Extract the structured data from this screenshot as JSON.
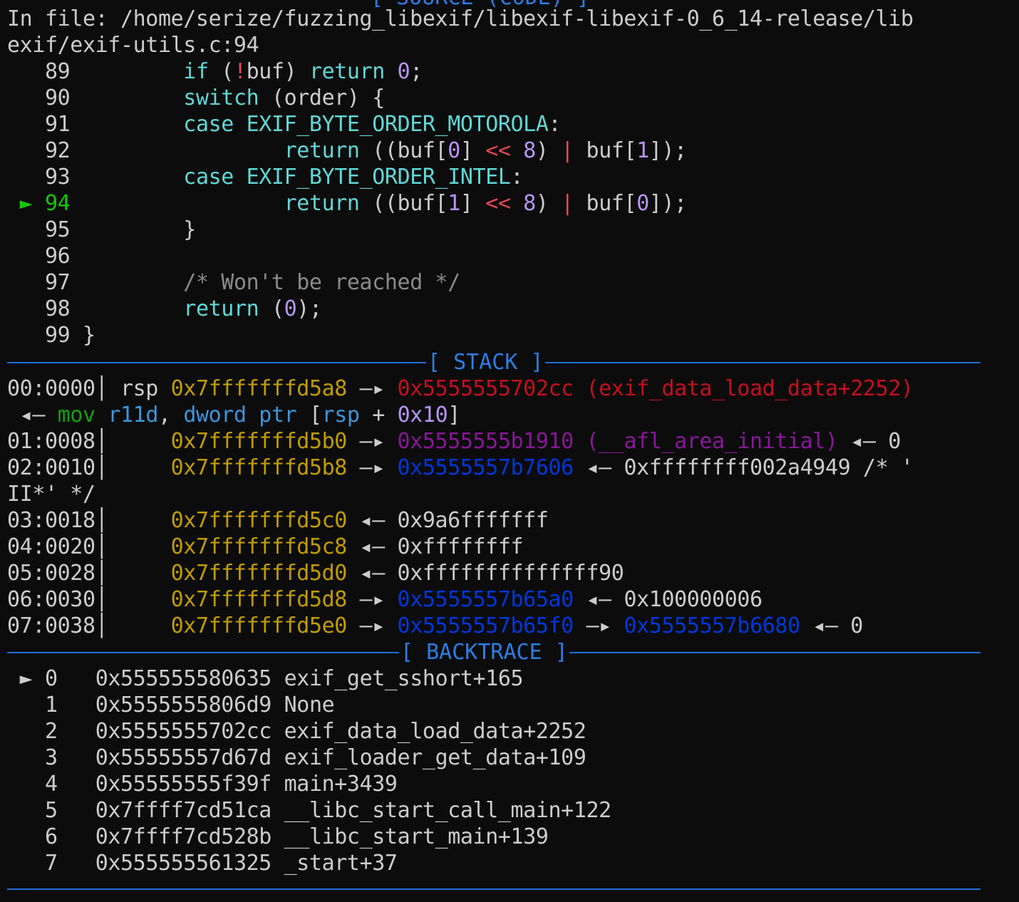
{
  "source": {
    "header_line1": "In file: /home/serize/fuzzing_libexif/libexif-libexif-0_6_14-release/lib",
    "header_line2": "exif/exif-utils.c:94",
    "current_marker": "►",
    "lines": [
      {
        "num": "89",
        "indent": "        ",
        "parts": [
          [
            "kw",
            "if"
          ],
          [
            "t",
            " ("
          ],
          [
            "op",
            "!"
          ],
          [
            "t",
            "buf) "
          ],
          [
            "kw",
            "return"
          ],
          [
            "t",
            " "
          ],
          [
            "num",
            "0"
          ],
          [
            "t",
            ";"
          ]
        ]
      },
      {
        "num": "90",
        "indent": "        ",
        "parts": [
          [
            "kw",
            "switch"
          ],
          [
            "t",
            " (order) {"
          ]
        ]
      },
      {
        "num": "91",
        "indent": "        ",
        "parts": [
          [
            "kw",
            "case"
          ],
          [
            "t",
            " "
          ],
          [
            "kw",
            "EXIF_BYTE_ORDER_MOTOROLA"
          ],
          [
            "t",
            ":"
          ]
        ]
      },
      {
        "num": "92",
        "indent": "                ",
        "parts": [
          [
            "kw",
            "return"
          ],
          [
            "t",
            " ((buf["
          ],
          [
            "num",
            "0"
          ],
          [
            "t",
            "] "
          ],
          [
            "op",
            "<<"
          ],
          [
            "t",
            " "
          ],
          [
            "num",
            "8"
          ],
          [
            "t",
            ") "
          ],
          [
            "op",
            "|"
          ],
          [
            "t",
            " buf["
          ],
          [
            "num",
            "1"
          ],
          [
            "t",
            "]);"
          ]
        ]
      },
      {
        "num": "93",
        "indent": "        ",
        "parts": [
          [
            "kw",
            "case"
          ],
          [
            "t",
            " "
          ],
          [
            "kw",
            "EXIF_BYTE_ORDER_INTEL"
          ],
          [
            "t",
            ":"
          ]
        ]
      },
      {
        "num": "94",
        "indent": "                ",
        "current": true,
        "parts": [
          [
            "kw",
            "return"
          ],
          [
            "t",
            " ((buf["
          ],
          [
            "num",
            "1"
          ],
          [
            "t",
            "] "
          ],
          [
            "op",
            "<<"
          ],
          [
            "t",
            " "
          ],
          [
            "num",
            "8"
          ],
          [
            "t",
            ") "
          ],
          [
            "op",
            "|"
          ],
          [
            "t",
            " buf["
          ],
          [
            "num",
            "0"
          ],
          [
            "t",
            "]);"
          ]
        ]
      },
      {
        "num": "95",
        "indent": "        ",
        "parts": [
          [
            "t",
            "}"
          ]
        ]
      },
      {
        "num": "96",
        "indent": "",
        "parts": []
      },
      {
        "num": "97",
        "indent": "        ",
        "parts": [
          [
            "cm",
            "/* Won't be reached */"
          ]
        ]
      },
      {
        "num": "98",
        "indent": "        ",
        "parts": [
          [
            "kw",
            "return"
          ],
          [
            "t",
            " ("
          ],
          [
            "num",
            "0"
          ],
          [
            "t",
            ");"
          ]
        ]
      },
      {
        "num": "99",
        "indent": "",
        "parts": [
          [
            "t",
            "}"
          ]
        ]
      }
    ]
  },
  "headers": {
    "top_partial": "[ SOURCE (CODE) ]",
    "stack": "[ STACK ]",
    "backtrace": "[ BACKTRACE ]"
  },
  "stack": {
    "rows": [
      {
        "parts": [
          [
            "t",
            "00:0000"
          ],
          [
            "t",
            "│ "
          ],
          [
            "t",
            "rsp "
          ],
          [
            "ay",
            "0x7fffffffd5a8"
          ],
          [
            "t",
            " —▸ "
          ],
          [
            "ar",
            "0x5555555702cc (exif_data_load_data+2252)"
          ]
        ]
      },
      {
        "parts": [
          [
            "t",
            " ◂— "
          ],
          [
            "mn",
            "mov"
          ],
          [
            "t",
            " "
          ],
          [
            "rg",
            "r11d"
          ],
          [
            "t",
            ", "
          ],
          [
            "rg",
            "dword ptr"
          ],
          [
            "t",
            " ["
          ],
          [
            "rg",
            "rsp"
          ],
          [
            "t",
            " + "
          ],
          [
            "nv",
            "0x10"
          ],
          [
            "t",
            "]"
          ]
        ]
      },
      {
        "parts": [
          [
            "t",
            "01:0008"
          ],
          [
            "t",
            "│     "
          ],
          [
            "ay",
            "0x7fffffffd5b0"
          ],
          [
            "t",
            " —▸ "
          ],
          [
            "ap",
            "0x5555555b1910 (__afl_area_initial)"
          ],
          [
            "t",
            " ◂— 0"
          ]
        ]
      },
      {
        "parts": [
          [
            "t",
            "02:0010"
          ],
          [
            "t",
            "│     "
          ],
          [
            "ay",
            "0x7fffffffd5b8"
          ],
          [
            "t",
            " —▸ "
          ],
          [
            "ab",
            "0x5555557b7606"
          ],
          [
            "t",
            " ◂— 0xffffffff002a4949 /* '"
          ]
        ]
      },
      {
        "parts": [
          [
            "t",
            "II*' */"
          ]
        ]
      },
      {
        "parts": [
          [
            "t",
            "03:0018"
          ],
          [
            "t",
            "│     "
          ],
          [
            "ay",
            "0x7fffffffd5c0"
          ],
          [
            "t",
            " ◂— 0x9a6fffffff"
          ]
        ]
      },
      {
        "parts": [
          [
            "t",
            "04:0020"
          ],
          [
            "t",
            "│     "
          ],
          [
            "ay",
            "0x7fffffffd5c8"
          ],
          [
            "t",
            " ◂— 0xffffffff"
          ]
        ]
      },
      {
        "parts": [
          [
            "t",
            "05:0028"
          ],
          [
            "t",
            "│     "
          ],
          [
            "ay",
            "0x7fffffffd5d0"
          ],
          [
            "t",
            " ◂— 0xffffffffffffff90"
          ]
        ]
      },
      {
        "parts": [
          [
            "t",
            "06:0030"
          ],
          [
            "t",
            "│     "
          ],
          [
            "ay",
            "0x7fffffffd5d8"
          ],
          [
            "t",
            " —▸ "
          ],
          [
            "ab",
            "0x5555557b65a0"
          ],
          [
            "t",
            " ◂— 0x100000006"
          ]
        ]
      },
      {
        "parts": [
          [
            "t",
            "07:0038"
          ],
          [
            "t",
            "│     "
          ],
          [
            "ay",
            "0x7fffffffd5e0"
          ],
          [
            "t",
            " —▸ "
          ],
          [
            "ab",
            "0x5555557b65f0"
          ],
          [
            "t",
            " —▸ "
          ],
          [
            "ab",
            "0x5555557b6680"
          ],
          [
            "t",
            " ◂— 0"
          ]
        ]
      }
    ]
  },
  "backtrace": {
    "frames": [
      {
        "marker": "►",
        "idx": "0",
        "addr": "0x555555580635",
        "sym": "exif_get_sshort+165"
      },
      {
        "marker": " ",
        "idx": "1",
        "addr": "0x5555555806d9",
        "sym": "None"
      },
      {
        "marker": " ",
        "idx": "2",
        "addr": "0x5555555702cc",
        "sym": "exif_data_load_data+2252"
      },
      {
        "marker": " ",
        "idx": "3",
        "addr": "0x55555557d67d",
        "sym": "exif_loader_get_data+109"
      },
      {
        "marker": " ",
        "idx": "4",
        "addr": "0x55555555f39f",
        "sym": "main+3439"
      },
      {
        "marker": " ",
        "idx": "5",
        "addr": "0x7ffff7cd51ca",
        "sym": "__libc_start_call_main+122"
      },
      {
        "marker": " ",
        "idx": "6",
        "addr": "0x7ffff7cd528b",
        "sym": "__libc_start_main+139"
      },
      {
        "marker": " ",
        "idx": "7",
        "addr": "0x555555561325",
        "sym": "_start+37"
      }
    ]
  },
  "colors": {
    "background": "#0c0c0c",
    "separator": "#1f6fd8",
    "keyword": "#61d6d6",
    "number": "#b794f4",
    "stack_addr": "#c19c00",
    "code_ptr": "#c50f1f",
    "data_ptr": "#881798",
    "heap_ptr": "#0037da"
  }
}
